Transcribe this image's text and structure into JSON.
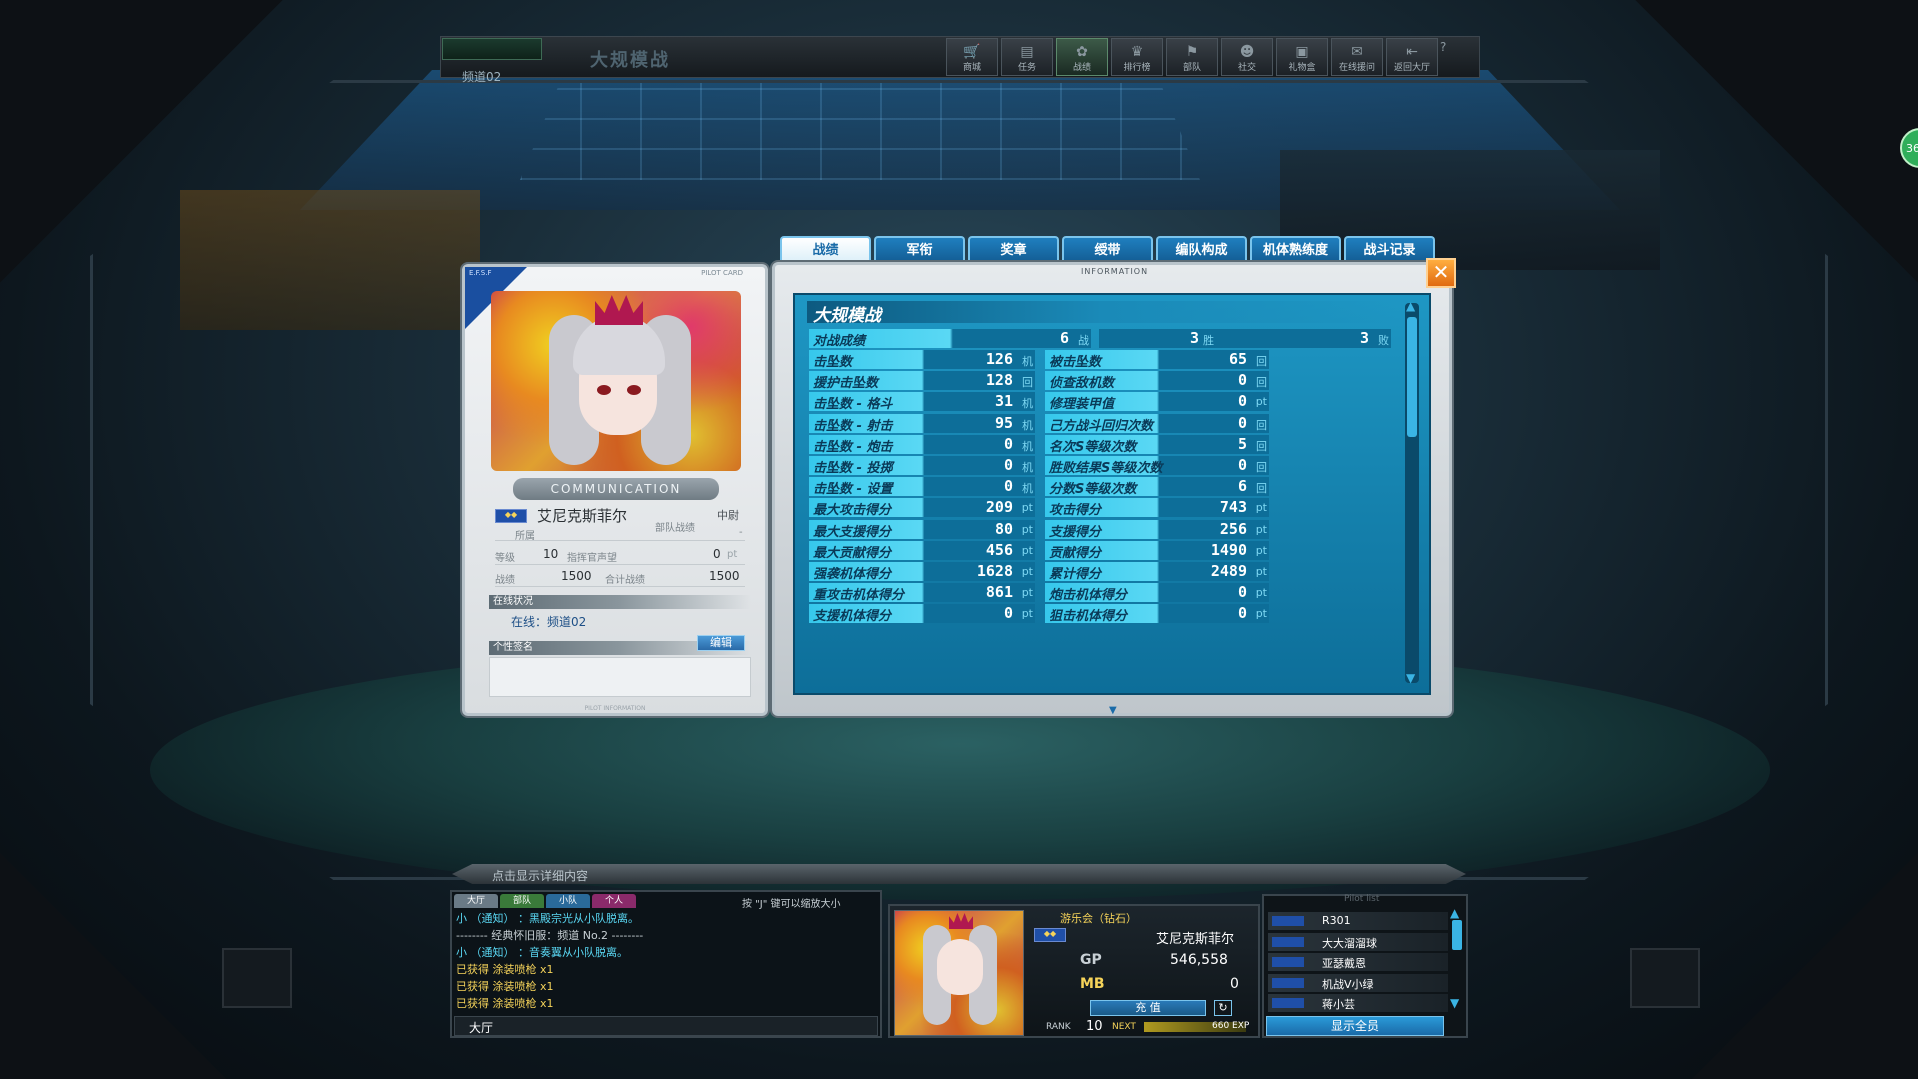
{
  "topbar": {
    "channel_label": "频道02",
    "mode_title": "大规模战",
    "nav": [
      {
        "icon": "cart-icon",
        "label": "商城"
      },
      {
        "icon": "quest-icon",
        "label": "任务"
      },
      {
        "icon": "battle-icon",
        "label": "战绩"
      },
      {
        "icon": "trophy-icon",
        "label": "排行榜"
      },
      {
        "icon": "squad-icon",
        "label": "部队"
      },
      {
        "icon": "social-icon",
        "label": "社交"
      },
      {
        "icon": "gift-icon",
        "label": "礼物盒"
      },
      {
        "icon": "support-icon",
        "label": "在线援问"
      },
      {
        "icon": "return-icon",
        "label": "返回大厅"
      }
    ],
    "help": "?",
    "side_badge": "36"
  },
  "card": {
    "header": "PILOT CARD",
    "corner": "E.F.S.F",
    "comm": "COMMUNICATION",
    "name": "艾尼克斯菲尔",
    "rank": "中尉",
    "belong_label": "所属",
    "squad_record_label": "部队战绩",
    "squad_record_value": "-",
    "level_label": "等级",
    "level_value": "10",
    "reputation_label": "指挥官声望",
    "reputation_value": "0",
    "reputation_unit": "pt",
    "record_label": "战绩",
    "record_value": "1500",
    "total_label": "合计战绩",
    "total_value": "1500",
    "online_title": "在线状况",
    "online_text": "在线：频道02",
    "sig_title": "个性签名",
    "edit_label": "编辑",
    "footer": "PILOT INFORMATION"
  },
  "panel": {
    "tabs": [
      "战绩",
      "军衔",
      "奖章",
      "绶带",
      "编队构成",
      "机体熟练度",
      "战斗记录"
    ],
    "info": "INFORMATION",
    "close": "✕",
    "section_title": "大规模战",
    "record_row": {
      "label": "对战成绩",
      "battles": "6",
      "battles_unit": "战",
      "wins": "3",
      "wins_unit": "胜",
      "losses": "3",
      "losses_unit": "败"
    },
    "rows": [
      {
        "l1": "击坠数",
        "v1": "126",
        "u1": "机",
        "l2": "被击坠数",
        "v2": "65",
        "u2": "回"
      },
      {
        "l1": "援护击坠数",
        "v1": "128",
        "u1": "回",
        "l2": "侦查敌机数",
        "v2": "0",
        "u2": "回"
      },
      {
        "l1": "击坠数 - 格斗",
        "v1": "31",
        "u1": "机",
        "l2": "修理装甲值",
        "v2": "0",
        "u2": "pt"
      },
      {
        "l1": "击坠数 - 射击",
        "v1": "95",
        "u1": "机",
        "l2": "己方战斗回归次数",
        "v2": "0",
        "u2": "回"
      },
      {
        "l1": "击坠数 - 炮击",
        "v1": "0",
        "u1": "机",
        "l2": "名次S等级次数",
        "v2": "5",
        "u2": "回"
      },
      {
        "l1": "击坠数 - 投掷",
        "v1": "0",
        "u1": "机",
        "l2": "胜败结果S等级次数",
        "v2": "0",
        "u2": "回"
      },
      {
        "l1": "击坠数 - 设置",
        "v1": "0",
        "u1": "机",
        "l2": "分数S等级次数",
        "v2": "6",
        "u2": "回"
      },
      {
        "l1": "最大攻击得分",
        "v1": "209",
        "u1": "pt",
        "l2": "攻击得分",
        "v2": "743",
        "u2": "pt"
      },
      {
        "l1": "最大支援得分",
        "v1": "80",
        "u1": "pt",
        "l2": "支援得分",
        "v2": "256",
        "u2": "pt"
      },
      {
        "l1": "最大贡献得分",
        "v1": "456",
        "u1": "pt",
        "l2": "贡献得分",
        "v2": "1490",
        "u2": "pt"
      },
      {
        "l1": "强袭机体得分",
        "v1": "1628",
        "u1": "pt",
        "l2": "累计得分",
        "v2": "2489",
        "u2": "pt"
      },
      {
        "l1": "重攻击机体得分",
        "v1": "861",
        "u1": "pt",
        "l2": "炮击机体得分",
        "v2": "0",
        "u2": "pt"
      },
      {
        "l1": "支援机体得分",
        "v1": "0",
        "u1": "pt",
        "l2": "狙击机体得分",
        "v2": "0",
        "u2": "pt"
      }
    ]
  },
  "chat": {
    "bar": "点击显示详细内容",
    "tabs": [
      "大厅",
      "部队",
      "小队",
      "个人"
    ],
    "hint": "按 \"J\" 键可以缩放大小",
    "lines": [
      {
        "text": "小 （通知）           ：黑殿宗光从小队脱离。",
        "color": "#5ad8f4"
      },
      {
        "text": "-------- 经典怀旧服：频道 No.2 --------",
        "color": "#c8d0d5"
      },
      {
        "text": "小 （通知）           ：音奏翼从小队脱离。",
        "color": "#5ad8f4"
      },
      {
        "text": "已获得 涂装喷枪 x1",
        "color": "#f5d35a"
      },
      {
        "text": "已获得 涂装喷枪 x1",
        "color": "#f5d35a"
      },
      {
        "text": "已获得 涂装喷枪 x1",
        "color": "#f5d35a"
      }
    ],
    "input_label": "大厅"
  },
  "player": {
    "guild": "游乐会（钻石）",
    "name": "艾尼克斯菲尔",
    "gp_label": "GP",
    "gp_value": "546,558",
    "mb_label": "MB",
    "mb_value": "0",
    "charge": "充 值",
    "rank_label": "RANK",
    "rank_value": "10",
    "next_label": "NEXT",
    "exp_text": "660 EXP"
  },
  "pilotlist": {
    "header": "Pilot list",
    "items": [
      "R301",
      "大大溜溜球",
      "亚瑟戴恩",
      "机战V小绿",
      "蒋小芸"
    ],
    "show_all": "显示全员"
  }
}
